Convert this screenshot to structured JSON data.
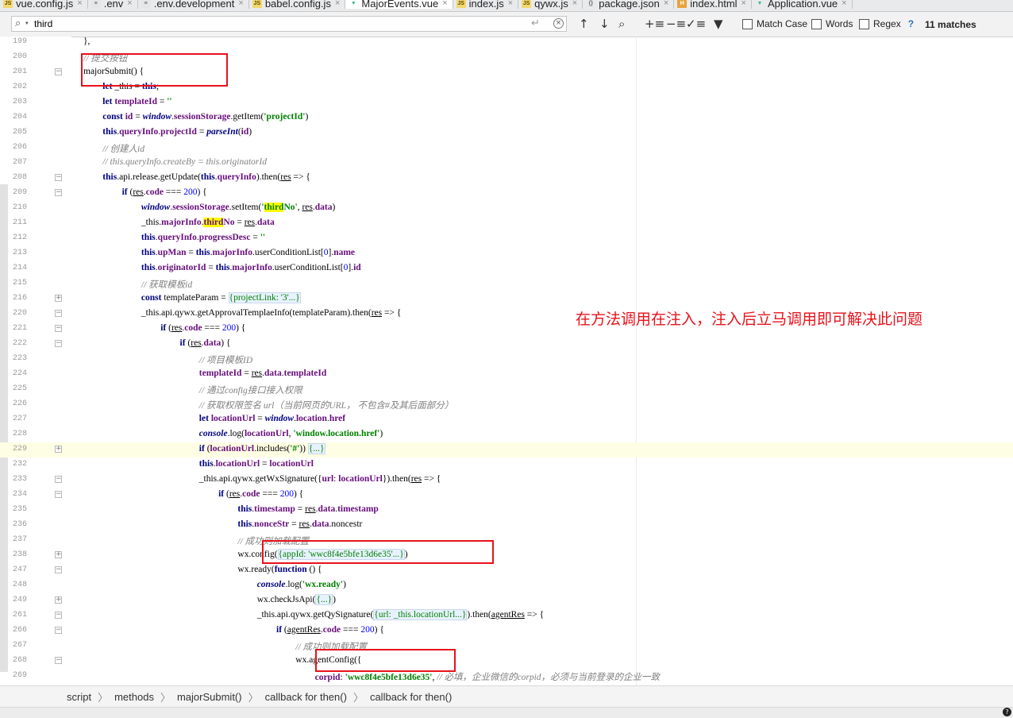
{
  "tabs": [
    {
      "label": "vue.config.js",
      "icon": "js-file-icon"
    },
    {
      "label": ".env",
      "icon": "env-file-icon"
    },
    {
      "label": ".env.development",
      "icon": "env-file-icon"
    },
    {
      "label": "babel.config.js",
      "icon": "js-file-icon"
    },
    {
      "label": "MajorEvents.vue",
      "icon": "vue-file-icon",
      "active": true
    },
    {
      "label": "index.js",
      "icon": "js-file-icon"
    },
    {
      "label": "qywx.js",
      "icon": "js-file-icon"
    },
    {
      "label": "package.json",
      "icon": "json-file-icon"
    },
    {
      "label": "index.html",
      "icon": "html-file-icon"
    },
    {
      "label": "Application.vue",
      "icon": "vue-file-icon"
    }
  ],
  "search": {
    "value": "third",
    "match_case": "Match Case",
    "words": "Words",
    "regex": "Regex",
    "help": "?",
    "matches": "11 matches"
  },
  "lines": [
    {
      "n": "199",
      "indent": 5,
      "fold": "",
      "code": "},"
    },
    {
      "n": "200",
      "indent": 5,
      "fold": "",
      "code": "// 提交按钮"
    },
    {
      "n": "201",
      "indent": 5,
      "fold": "-",
      "code": "majorSubmit() {"
    },
    {
      "n": "202",
      "indent": 6,
      "fold": "",
      "code": "let _this = this;"
    },
    {
      "n": "203",
      "indent": 6,
      "fold": "",
      "code": "let templateId = ''"
    },
    {
      "n": "204",
      "indent": 6,
      "fold": "",
      "code": "const id = window.sessionStorage.getItem('projectId')"
    },
    {
      "n": "205",
      "indent": 6,
      "fold": "",
      "code": "this.queryInfo.projectId = parseInt(id)"
    },
    {
      "n": "206",
      "indent": 6,
      "fold": "",
      "code": "// 创建人id"
    },
    {
      "n": "207",
      "indent": 6,
      "fold": "",
      "code": "// this.queryInfo.createBy = this.originatorId"
    },
    {
      "n": "208",
      "indent": 6,
      "fold": "-",
      "code": "this.$api.release.getUpdate(this.queryInfo).then(res => {"
    },
    {
      "n": "209",
      "indent": 7,
      "fold": "-",
      "code": "if (res.code === 200) {"
    },
    {
      "n": "210",
      "indent": 8,
      "fold": "",
      "code": "window.sessionStorage.setItem('thirdNo', res.data)"
    },
    {
      "n": "211",
      "indent": 8,
      "fold": "",
      "code": "_this.majorInfo.thirdNo = res.data"
    },
    {
      "n": "212",
      "indent": 8,
      "fold": "",
      "code": "this.queryInfo.progressDesc = ''"
    },
    {
      "n": "213",
      "indent": 8,
      "fold": "",
      "code": "this.upMan = this.majorInfo.userConditionList[0].name"
    },
    {
      "n": "214",
      "indent": 8,
      "fold": "",
      "code": "this.originatorId = this.majorInfo.userConditionList[0].id"
    },
    {
      "n": "215",
      "indent": 8,
      "fold": "",
      "code": "// 获取模板id"
    },
    {
      "n": "216",
      "indent": 8,
      "fold": "+",
      "code": "const templateParam = {projectLink: '3'...}"
    },
    {
      "n": "220",
      "indent": 8,
      "fold": "-",
      "code": "_this.$api.qywx.getApprovalTemplaeInfo(templateParam).then(res => {"
    },
    {
      "n": "221",
      "indent": 9,
      "fold": "-",
      "code": "if (res.code === 200) {"
    },
    {
      "n": "222",
      "indent": 10,
      "fold": "-",
      "code": "if (res.data) {"
    },
    {
      "n": "223",
      "indent": 11,
      "fold": "",
      "code": "// 项目模板ID"
    },
    {
      "n": "224",
      "indent": 11,
      "fold": "",
      "code": "templateId = res.data.templateId"
    },
    {
      "n": "225",
      "indent": 11,
      "fold": "",
      "code": "// 通过config接口接入权限"
    },
    {
      "n": "226",
      "indent": 11,
      "fold": "",
      "code": "// 获取权限签名 url（当前网页的URL， 不包含#及其后面部分）"
    },
    {
      "n": "227",
      "indent": 11,
      "fold": "",
      "code": "let locationUrl = window.location.href"
    },
    {
      "n": "228",
      "indent": 11,
      "fold": "",
      "code": "console.log(locationUrl, 'window.location.href')"
    },
    {
      "n": "229",
      "indent": 11,
      "fold": "+",
      "code": "if (locationUrl.includes('#')) {...}",
      "current": true
    },
    {
      "n": "232",
      "indent": 11,
      "fold": "",
      "code": "this.locationUrl = locationUrl"
    },
    {
      "n": "233",
      "indent": 11,
      "fold": "-",
      "code": "_this.$api.qywx.getWxSignature({url: locationUrl}).then(res => {"
    },
    {
      "n": "234",
      "indent": 12,
      "fold": "-",
      "code": "if (res.code === 200) {"
    },
    {
      "n": "235",
      "indent": 13,
      "fold": "",
      "code": "this.timestamp = res.data.timestamp"
    },
    {
      "n": "236",
      "indent": 13,
      "fold": "",
      "code": "this.nonceStr = res.data.noncestr"
    },
    {
      "n": "237",
      "indent": 13,
      "fold": "",
      "code": "// 成功则加载配置"
    },
    {
      "n": "238",
      "indent": 13,
      "fold": "+",
      "code": "wx.config({appId: 'wwc8f4e5bfe13d6e35'...})"
    },
    {
      "n": "247",
      "indent": 13,
      "fold": "-",
      "code": "wx.ready(function () {"
    },
    {
      "n": "248",
      "indent": 14,
      "fold": "",
      "code": "console.log('wx.ready')"
    },
    {
      "n": "249",
      "indent": 14,
      "fold": "+",
      "code": "wx.checkJsApi({...})"
    },
    {
      "n": "261",
      "indent": 14,
      "fold": "-",
      "code": "_this.$api.qywx.getQySignature({url: _this.locationUrl...}).then(agentRes => {"
    },
    {
      "n": "266",
      "indent": 15,
      "fold": "-",
      "code": "if (agentRes.code === 200) {"
    },
    {
      "n": "267",
      "indent": 16,
      "fold": "",
      "code": "// 成功则加载配置"
    },
    {
      "n": "268",
      "indent": 16,
      "fold": "-",
      "code": "wx.agentConfig({"
    },
    {
      "n": "269",
      "indent": 17,
      "fold": "",
      "code": "corpid: 'wwc8f4e5bfe13d6e35', // 必填，企业微信的corpid，必须与当前登录的企业一致"
    }
  ],
  "annotation": "在方法调用在注入，注入后立马调用即可解决此问题",
  "breadcrumbs": [
    "script",
    "methods",
    "majorSubmit()",
    "callback for then()",
    "callback for then()"
  ],
  "colors": {
    "highlight": "#ffff00",
    "annotation_red": "#e8121b",
    "keyword": "#000080",
    "string": "#008000"
  }
}
